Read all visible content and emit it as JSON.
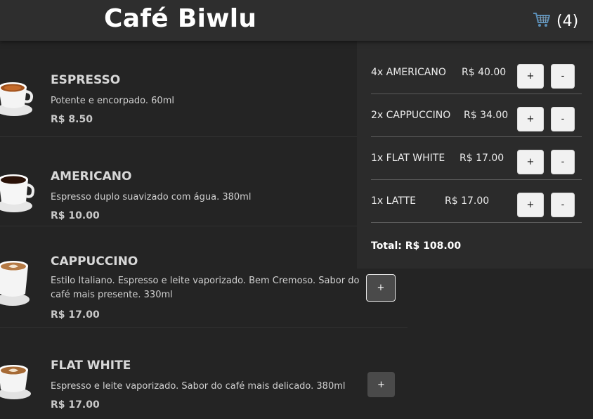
{
  "header": {
    "brand": "Café Biwlu",
    "cart_count": "(4)",
    "cart_icon": "shopping-cart-icon"
  },
  "menu": {
    "items": [
      {
        "name": "ESPRESSO",
        "description": "Potente e encorpado. 60ml",
        "price": "R$ 8.50",
        "add_label": "+"
      },
      {
        "name": "AMERICANO",
        "description": "Espresso duplo suavizado com água. 380ml",
        "price": "R$ 10.00",
        "add_label": "+"
      },
      {
        "name": "CAPPUCCINO",
        "description": "Estilo Italiano. Espresso e leite vaporizado. Bem Cremoso. Sabor do café mais presente. 330ml",
        "price": "R$ 17.00",
        "add_label": "+"
      },
      {
        "name": "FLAT WHITE",
        "description": "Espresso e leite vaporizado. Sabor do café mais delicado. 380ml",
        "price": "R$ 17.00",
        "add_label": "+"
      }
    ]
  },
  "cart": {
    "rows": [
      {
        "label": "4x AMERICANO",
        "price": "R$ 40.00",
        "plus": "+",
        "minus": "-"
      },
      {
        "label": "2x CAPPUCCINO",
        "price": "R$ 34.00",
        "plus": "+",
        "minus": "-"
      },
      {
        "label": "1x FLAT WHITE",
        "price": "R$ 17.00",
        "plus": "+",
        "minus": "-"
      },
      {
        "label": "1x LATTE",
        "price": "R$ 17.00",
        "plus": "+",
        "minus": "-"
      }
    ],
    "total": "Total: R$ 108.00"
  },
  "colors": {
    "background": "#242424",
    "header": "#2e2e2e",
    "panel": "#2b2b2b",
    "add_button": "#4a4a4a",
    "qty_button": "#f1f1f1",
    "cart_icon": "#5a8db5"
  }
}
